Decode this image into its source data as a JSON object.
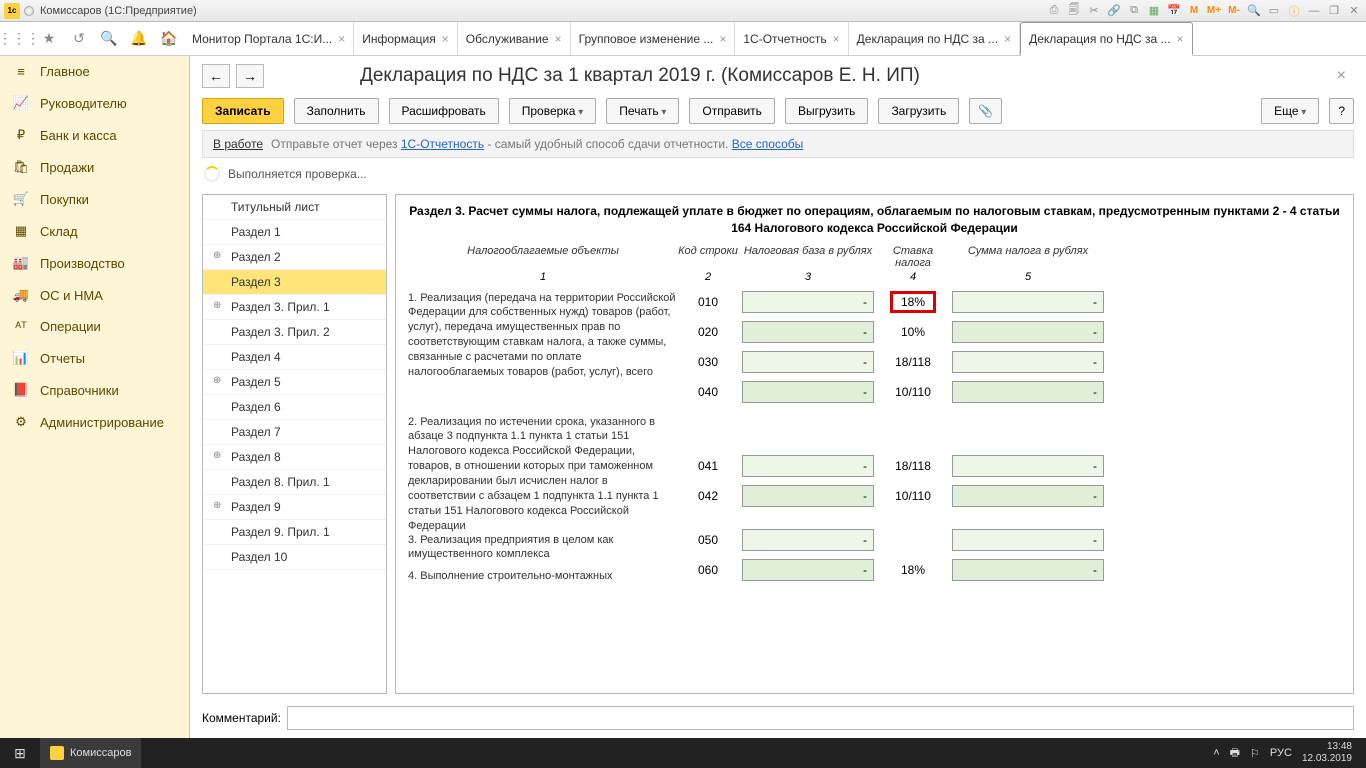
{
  "window": {
    "title": "Комиссаров  (1С:Предприятие)"
  },
  "tabs": {
    "items": [
      "Монитор Портала 1С:И...",
      "Информация",
      "Обслуживание",
      "Групповое изменение ...",
      "1С-Отчетность",
      "Декларация по НДС за ...",
      "Декларация по НДС за ..."
    ]
  },
  "sidebar": {
    "items": [
      {
        "icon": "≡",
        "label": "Главное"
      },
      {
        "icon": "📈",
        "label": "Руководителю"
      },
      {
        "icon": "₽",
        "label": "Банк и касса"
      },
      {
        "icon": "🛍",
        "label": "Продажи"
      },
      {
        "icon": "🛒",
        "label": "Покупки"
      },
      {
        "icon": "▦",
        "label": "Склад"
      },
      {
        "icon": "🏭",
        "label": "Производство"
      },
      {
        "icon": "🚚",
        "label": "ОС и НМА"
      },
      {
        "icon": "ᴬᵀ",
        "label": "Операции"
      },
      {
        "icon": "📊",
        "label": "Отчеты"
      },
      {
        "icon": "📕",
        "label": "Справочники"
      },
      {
        "icon": "⚙",
        "label": "Администрирование"
      }
    ]
  },
  "page": {
    "title": "Декларация по НДС за 1 квартал 2019 г. (Комиссаров Е. Н. ИП)",
    "toolbar": {
      "save": "Записать",
      "fill": "Заполнить",
      "decipher": "Расшифровать",
      "check": "Проверка",
      "print": "Печать",
      "send": "Отправить",
      "export": "Выгрузить",
      "import": "Загрузить",
      "more": "Еще"
    },
    "status": {
      "label": "В работе",
      "hint": "Отправьте отчет через ",
      "link1": "1С-Отчетность",
      "hint2": " - самый удобный способ сдачи отчетности. ",
      "link2": "Все способы"
    },
    "progress": "Выполняется проверка...",
    "tree": [
      "Титульный лист",
      "Раздел 1",
      "Раздел 2",
      "Раздел 3",
      "Раздел 3. Прил. 1",
      "Раздел 3. Прил. 2",
      "Раздел 4",
      "Раздел 5",
      "Раздел 6",
      "Раздел 7",
      "Раздел 8",
      "Раздел 8. Прил. 1",
      "Раздел 9",
      "Раздел 9. Прил. 1",
      "Раздел 10"
    ],
    "section": {
      "title": "Раздел 3. Расчет суммы налога, подлежащей уплате в бюджет по операциям, облагаемым по налоговым ставкам, предусмотренным пунктами 2 - 4 статьи 164 Налогового кодекса Российской Федерации",
      "headers": {
        "c1": "Налогооблагаемые объекты",
        "c2": "Код строки",
        "c3": "Налоговая база в рублях",
        "c4": "Ставка налога",
        "c5": "Сумма налога в рублях"
      },
      "colnums": {
        "n1": "1",
        "n2": "2",
        "n3": "3",
        "n4": "4",
        "n5": "5"
      },
      "labels": {
        "l1": "1. Реализация (передача на территории Российской Федерации для собственных нужд) товаров (работ, услуг), передача имущественных прав по соответствующим ставкам налога, а также суммы, связанные с расчетами по оплате налогооблагаемых товаров (работ, услуг), всего",
        "l2": "2. Реализация по истечении срока, указанного в абзаце 3 подпункта 1.1 пункта 1 статьи 151 Налогового кодекса Российской Федерации, товаров, в отношении которых при таможенном декларировании был исчислен налог в соответствии с абзацем 1 подпункта 1.1 пункта 1 статьи 151 Налогового кодекса Российской Федерации",
        "l3": "3. Реализация предприятия в целом как имущественного комплекса",
        "l4": "4. Выполнение строительно-монтажных"
      },
      "rows": [
        {
          "code": "010",
          "rate": "18%",
          "hl": true
        },
        {
          "code": "020",
          "rate": "10%"
        },
        {
          "code": "030",
          "rate": "18/118"
        },
        {
          "code": "040",
          "rate": "10/110"
        },
        {
          "code": "041",
          "rate": "18/118"
        },
        {
          "code": "042",
          "rate": "10/110"
        },
        {
          "code": "050",
          "rate": ""
        },
        {
          "code": "060",
          "rate": "18%"
        }
      ]
    },
    "comment_label": "Комментарий:"
  },
  "taskbar": {
    "app": "Комиссаров",
    "lang": "РУС",
    "time": "13:48",
    "date": "12.03.2019"
  }
}
